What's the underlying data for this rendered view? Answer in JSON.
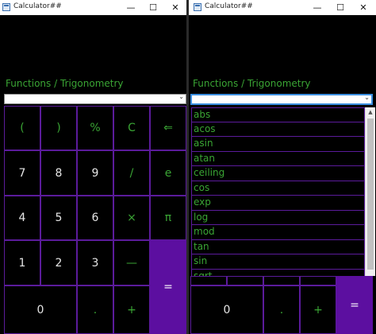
{
  "left_window": {
    "title": "Calculator##",
    "controls": {
      "minimize": "—",
      "maximize": "☐",
      "close": "✕"
    },
    "mode_label": "Functions / Trigonometry",
    "dropdown_value": "",
    "buttons": {
      "open_paren": "(",
      "close_paren": ")",
      "percent": "%",
      "clear": "C",
      "backspace": "⇐",
      "n7": "7",
      "n8": "8",
      "n9": "9",
      "divide": "/",
      "e": "e",
      "n4": "4",
      "n5": "5",
      "n6": "6",
      "multiply": "×",
      "pi": "π",
      "n1": "1",
      "n2": "2",
      "n3": "3",
      "minus": "—",
      "n0": "0",
      "dot": ".",
      "plus": "+",
      "equals": "="
    }
  },
  "right_window": {
    "title": "Calculator##",
    "controls": {
      "minimize": "—",
      "maximize": "☐",
      "close": "✕"
    },
    "mode_label": "Functions / Trigonometry",
    "dropdown_value": "",
    "functions": [
      "abs",
      "acos",
      "asin",
      "atan",
      "ceiling",
      "cos",
      "exp",
      "log",
      "mod",
      "tan",
      "sin",
      "sqrt"
    ],
    "buttons": {
      "n0": "0",
      "dot": ".",
      "plus": "+",
      "equals": "="
    }
  },
  "colors": {
    "accent_text": "#3aa534",
    "grid_border": "#5b1b9b",
    "equals_bg": "#5c0fa0"
  }
}
